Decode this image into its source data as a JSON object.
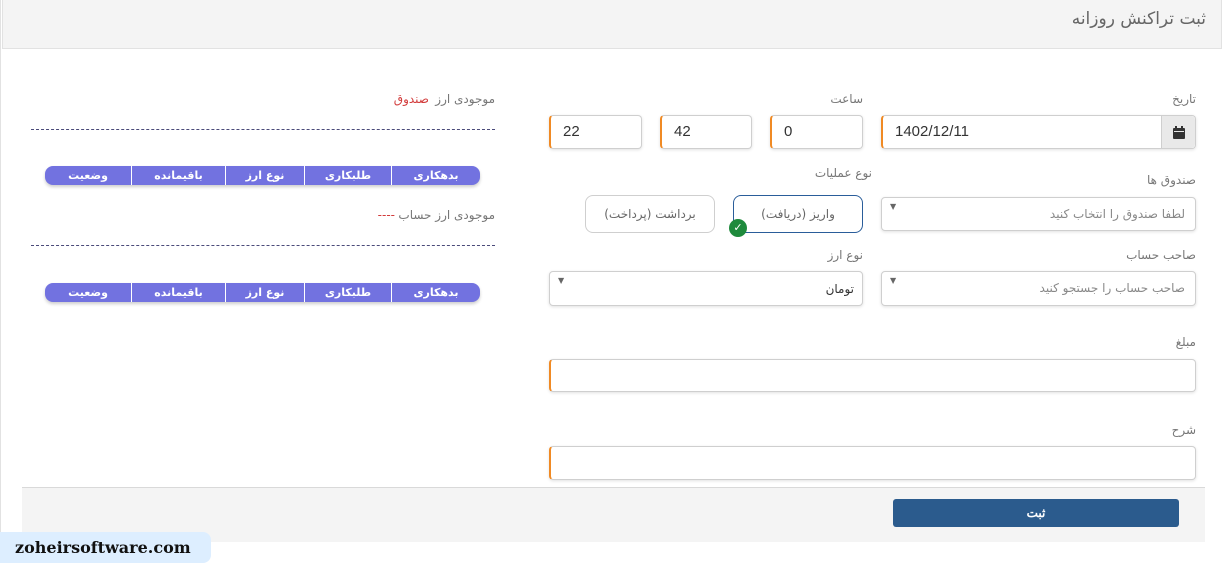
{
  "page": {
    "title": "ثبت تراکنش روزانه"
  },
  "form": {
    "date": {
      "label": "تاریخ",
      "value": "1402/12/11",
      "icon": "calendar-icon"
    },
    "time": {
      "label": "ساعت",
      "hour": "0",
      "minute": "42",
      "second": "22"
    },
    "cashbox": {
      "label": "صندوق ها",
      "placeholder": "لطفا صندوق را انتخاب کنید"
    },
    "operation": {
      "label": "نوع عملیات",
      "options": [
        "واریز (دریافت)",
        "برداشت (پرداخت)"
      ],
      "selected": "واریز (دریافت)",
      "selected_icon": "check-circle-icon"
    },
    "account_owner": {
      "label": "صاحب حساب",
      "placeholder": "صاحب حساب را جستجو کنید"
    },
    "currency": {
      "label": "نوع ارز",
      "value": "تومان"
    },
    "amount": {
      "label": "مبلغ",
      "value": ""
    },
    "description": {
      "label": "شرح",
      "value": ""
    },
    "submit_label": "ثبت"
  },
  "balances": {
    "cashbox_balance": {
      "label": "موجودی ارز",
      "value": "صندوق",
      "columns": [
        "بدهکاری",
        "طلبکاری",
        "نوع ارز",
        "باقیمانده",
        "وضعیت"
      ]
    },
    "account_balance": {
      "label": "موجودی ارز حساب",
      "value": "----",
      "columns": [
        "بدهکاری",
        "طلبکاری",
        "نوع ارز",
        "باقیمانده",
        "وضعیت"
      ]
    }
  },
  "watermark": "zoheirsoftware.com",
  "colors": {
    "accent": "#f08a24",
    "primary": "#2b5b8d",
    "table_header": "#7272e0",
    "success": "#1e8a3c",
    "alert": "#d23b3b"
  }
}
